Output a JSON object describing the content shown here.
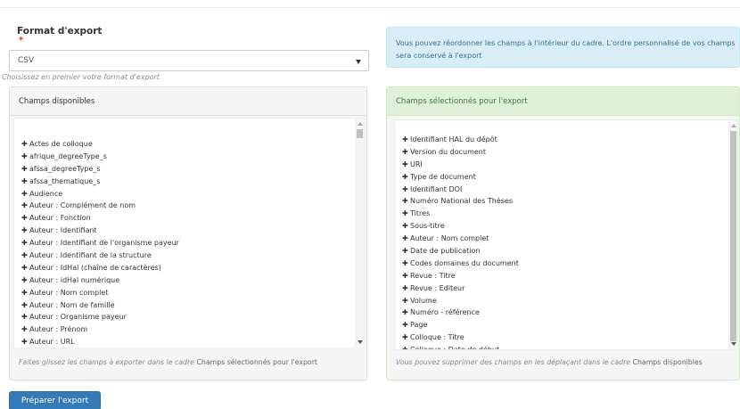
{
  "format": {
    "label": "Format d'export",
    "required_mark": "*",
    "selected": "CSV",
    "help": "Choisissez en premier votre format d'export"
  },
  "info": {
    "text": "Vous pouvez réordonner les champs à l'intérieur du cadre. L'ordre personnalisé de vos champs sera conservé à l'export"
  },
  "available": {
    "title": "Champs disponibles",
    "items": [
      "Actes de colloque",
      "afrique_degreeType_s",
      "afssa_degreeType_s",
      "afssa_thematique_s",
      "Audience",
      "Auteur : Complément de nom",
      "Auteur : Fonction",
      "Auteur : Identifiant",
      "Auteur : Identifiant de l'organisme payeur",
      "Auteur : Identifiant de la structure",
      "Auteur : IdHal (chaîne de caractères)",
      "Auteur : idHal numérique",
      "Auteur : Nom complet",
      "Auteur : Nom de famille",
      "Auteur : Organisme payeur",
      "Auteur : Prénom",
      "Auteur : URL"
    ],
    "footer_pre": "Faites glissez les champs à exporter dans le cadre ",
    "footer_name": "Champs sélectionnés pour l'export"
  },
  "selected": {
    "title": "Champs sélectionnés pour l'export",
    "items": [
      "Identifiant HAL du dépôt",
      "Version du document",
      "URI",
      "Type de document",
      "Identifiant DOI",
      "Numéro National des Thèses",
      "Titres",
      "Sous-titre",
      "Auteur : Nom complet",
      "Date de publication",
      "Codes domaines du document",
      "Revue : Titre",
      "Revue : Editeur",
      "Volume",
      "Numéro - référence",
      "Page",
      "Colloque : Titre",
      "Colloque : Date de début"
    ],
    "footer_pre": "Vous pouvez supprimer des champs en les déplaçant dans le cadre ",
    "footer_name": "Champs disponibles"
  },
  "button": {
    "label": "Préparer l'export"
  },
  "colors": {
    "primary": "#337ab7",
    "info_bg": "#d9edf7",
    "success_bg": "#dff0d8",
    "required": "#e02a2a"
  },
  "icons": {
    "item_handle": "move-icon"
  }
}
